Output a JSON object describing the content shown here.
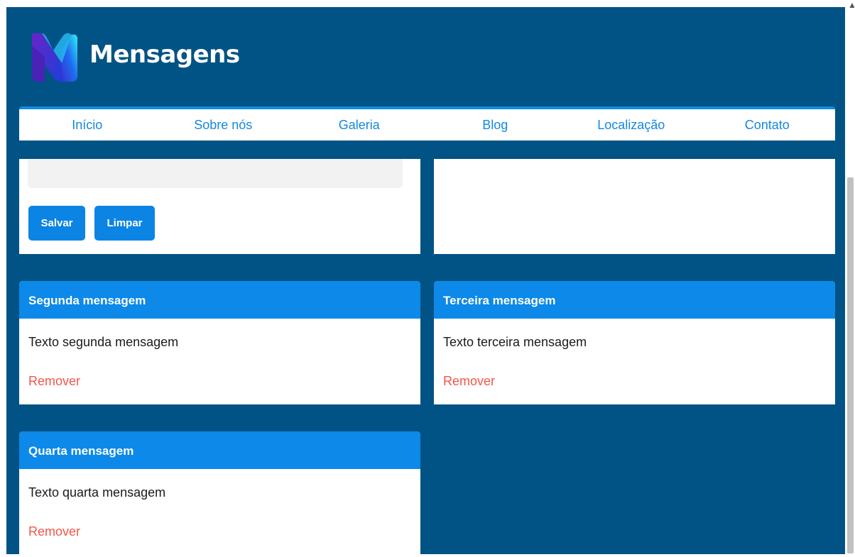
{
  "header": {
    "title": "Mensagens",
    "logo_icon": "m-logo-icon"
  },
  "nav": {
    "items": [
      "Início",
      "Sobre nós",
      "Galeria",
      "Blog",
      "Localização",
      "Contato"
    ]
  },
  "form": {
    "save_label": "Salvar",
    "clear_label": "Limpar"
  },
  "messages": [
    {
      "title": "Segunda mensagem",
      "text": "Texto segunda mensagem",
      "remove_label": "Remover"
    },
    {
      "title": "Terceira mensagem",
      "text": "Texto terceira mensagem",
      "remove_label": "Remover"
    },
    {
      "title": "Quarta mensagem",
      "text": "Texto quarta mensagem",
      "remove_label": "Remover"
    }
  ],
  "colors": {
    "background": "#005384",
    "accent": "#0c89e9",
    "nav_text": "#1388e0",
    "remove": "#f2564a"
  },
  "scroll_arrow": "▲"
}
